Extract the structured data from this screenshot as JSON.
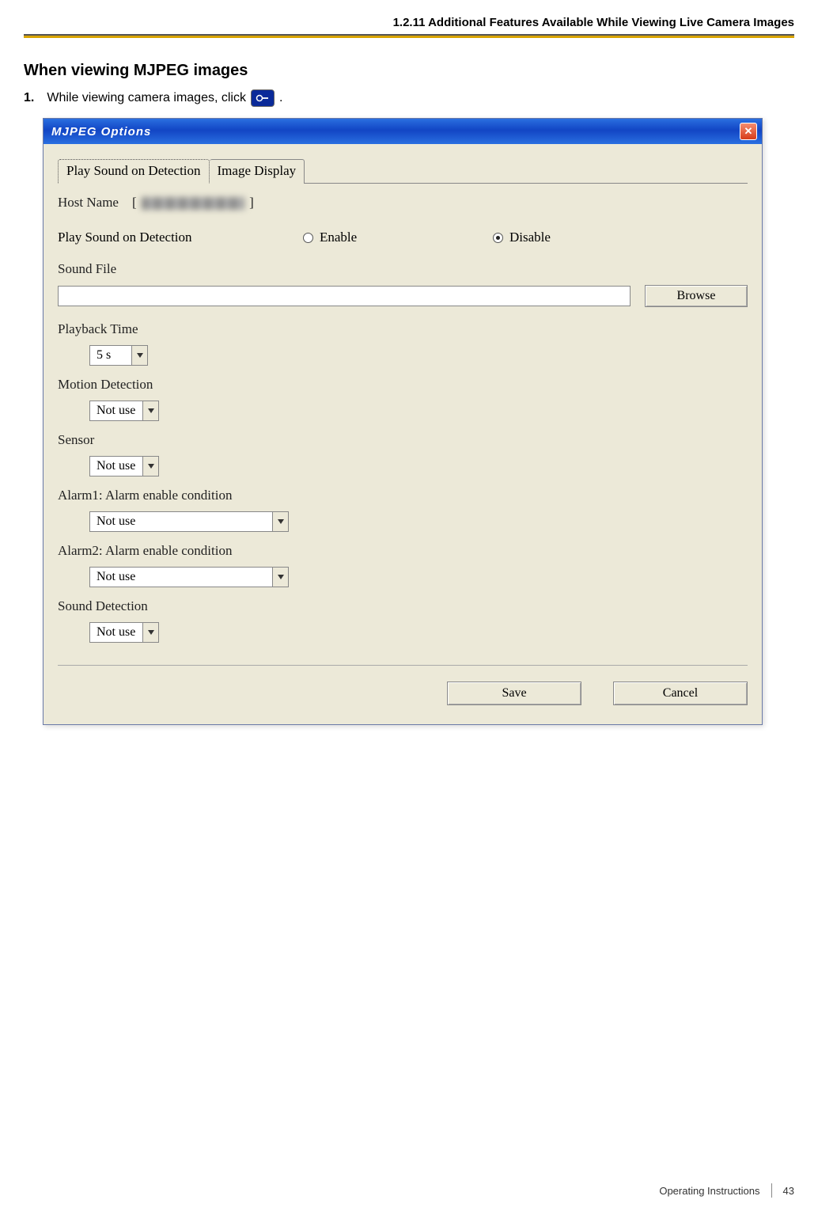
{
  "header": {
    "section_num": "1.2.11",
    "section_title": "Additional Features Available While Viewing Live Camera Images"
  },
  "subheading": "When viewing MJPEG images",
  "step": {
    "num": "1.",
    "text_before": "While viewing camera images, click ",
    "text_after": "."
  },
  "dialog": {
    "title": "MJPEG Options",
    "tabs": {
      "active": "Play Sound on Detection",
      "inactive": "Image Display"
    },
    "host_label": "Host Name",
    "bracket_open": "[",
    "bracket_close": "]",
    "play_sound": {
      "label": "Play Sound on Detection",
      "enable": "Enable",
      "disable": "Disable",
      "selected": "disable"
    },
    "sound_file_label": "Sound File",
    "browse": "Browse",
    "playback_time": {
      "label": "Playback Time",
      "value": "5 s"
    },
    "motion_detection": {
      "label": "Motion Detection",
      "value": "Not use"
    },
    "sensor": {
      "label": "Sensor",
      "value": "Not use"
    },
    "alarm1": {
      "label": "Alarm1: Alarm enable condition",
      "value": "Not use"
    },
    "alarm2": {
      "label": "Alarm2: Alarm enable condition",
      "value": "Not use"
    },
    "sound_detection": {
      "label": "Sound Detection",
      "value": "Not use"
    },
    "save": "Save",
    "cancel": "Cancel"
  },
  "footer": {
    "doc": "Operating Instructions",
    "page": "43"
  }
}
